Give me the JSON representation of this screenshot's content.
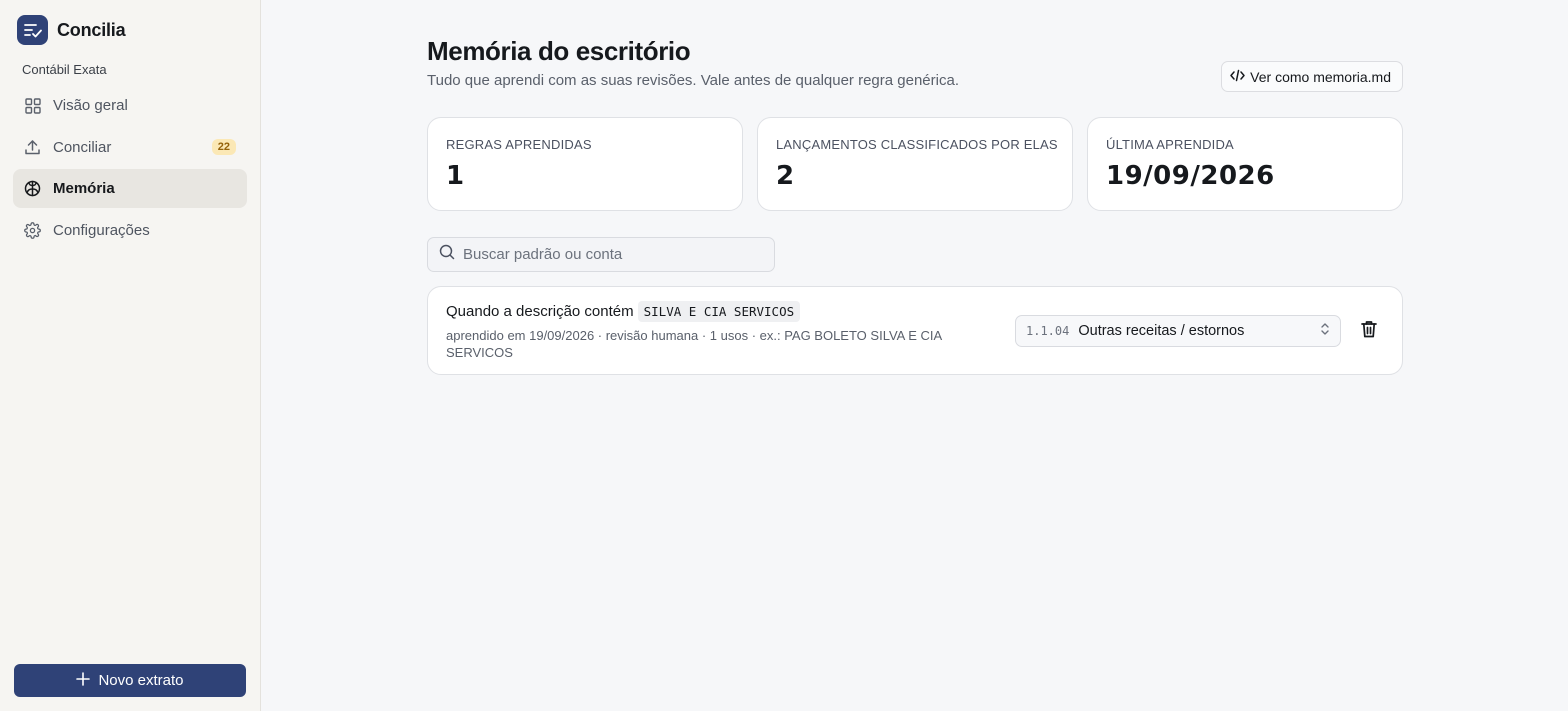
{
  "app": {
    "name": "Concilia",
    "org": "Contábil Exata"
  },
  "sidebar": {
    "items": [
      {
        "label": "Visão geral",
        "icon": "grid-icon"
      },
      {
        "label": "Conciliar",
        "icon": "upload-icon",
        "badge": "22"
      },
      {
        "label": "Memória",
        "icon": "brain-icon",
        "active": true
      },
      {
        "label": "Configurações",
        "icon": "gear-icon"
      }
    ],
    "new_button_label": "Novo extrato"
  },
  "header": {
    "title": "Memória do escritório",
    "subtitle": "Tudo que aprendi com as suas revisões. Vale antes de qualquer regra genérica.",
    "view_md_label": "Ver como memoria.md"
  },
  "stats": [
    {
      "label": "REGRAS APRENDIDAS",
      "value": "1"
    },
    {
      "label": "LANÇAMENTOS CLASSIFICADOS POR ELAS",
      "value": "2"
    },
    {
      "label": "ÚLTIMA APRENDIDA",
      "value": "19/09/2026"
    }
  ],
  "search": {
    "placeholder": "Buscar padrão ou conta"
  },
  "rules": [
    {
      "prefix": "Quando a descrição contém",
      "pattern": "SILVA E CIA SERVICOS",
      "meta": "aprendido em 19/09/2026 · revisão humana · 1 usos · ex.: PAG BOLETO SILVA E CIA SERVICOS",
      "account_code": "1.1.04",
      "account_name": "Outras receitas / estornos"
    }
  ],
  "colors": {
    "brand": "#2f4277",
    "badge_bg": "#fbe8b5",
    "badge_fg": "#94620a"
  }
}
